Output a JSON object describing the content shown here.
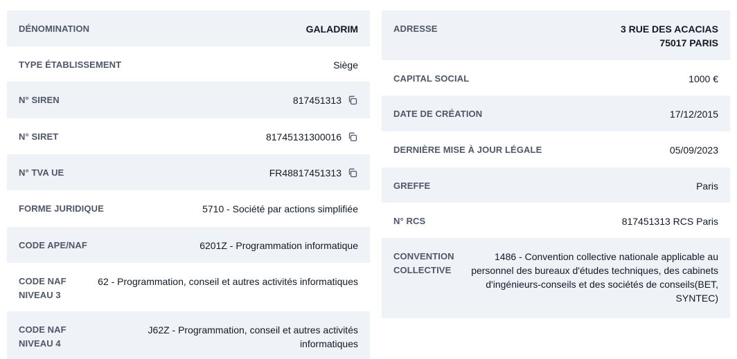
{
  "left": [
    {
      "label": "DÉNOMINATION",
      "value": "GALADRIM"
    },
    {
      "label": "TYPE ÉTABLISSEMENT",
      "value": "Siège"
    },
    {
      "label": "N° SIREN",
      "value": "817451313",
      "copy_icon": "copy-icon"
    },
    {
      "label": "N° SIRET",
      "value": "81745131300016",
      "copy_icon": "copy-icon"
    },
    {
      "label": "N° TVA UE",
      "value": "FR48817451313",
      "copy_icon": "copy-icon"
    },
    {
      "label": "FORME JURIDIQUE",
      "value": "5710 - Société par actions simplifiée"
    },
    {
      "label": "CODE APE/NAF",
      "value": "6201Z - Programmation informatique"
    },
    {
      "label": "CODE NAF NIVEAU 3",
      "value": "62 - Programmation, conseil et autres activités informatiques"
    },
    {
      "label": "CODE NAF NIVEAU 4",
      "value": "J62Z - Programmation, conseil et autres activités informatiques"
    }
  ],
  "right": [
    {
      "label": "ADRESSE",
      "value": "3 RUE DES ACACIAS\n75017  PARIS"
    },
    {
      "label": "CAPITAL SOCIAL",
      "value": "1000 €"
    },
    {
      "label": "DATE DE CRÉATION",
      "value": "17/12/2015"
    },
    {
      "label": "DERNIÈRE MISE À JOUR LÉGALE",
      "value": "05/09/2023"
    },
    {
      "label": "GREFFE",
      "value": "Paris"
    },
    {
      "label": "N° RCS",
      "value": "817451313 RCS Paris"
    },
    {
      "label": "CONVENTION COLLECTIVE",
      "value": "1486 - Convention collective nationale applicable au personnel des bureaux d'études techniques, des cabinets d'ingénieurs-conseils et des sociétés de conseils(BET, SYNTEC)"
    }
  ],
  "colors": {
    "row_alt_bg": "#eff2f6",
    "label": "#4e5668",
    "value": "#111827"
  }
}
